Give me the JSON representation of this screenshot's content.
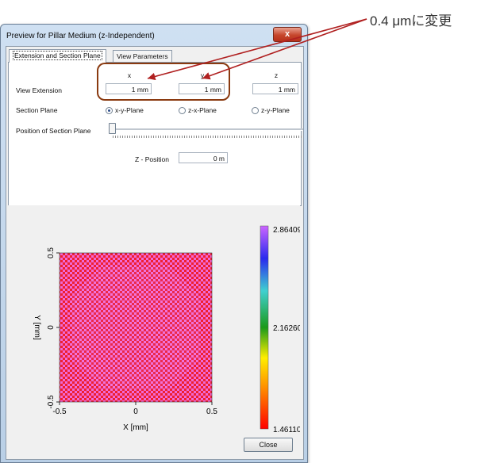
{
  "window": {
    "title": "Preview for Pillar Medium (z-Independent)",
    "close_glyph": "x"
  },
  "tabs": [
    {
      "label": "Extension and Section Plane",
      "active": true
    },
    {
      "label": "View Parameters",
      "active": false
    }
  ],
  "extension": {
    "headers": {
      "x": "x",
      "y": "y",
      "z": "z"
    },
    "label": "View Extension",
    "x_value": "1 mm",
    "y_value": "1 mm",
    "z_value": "1 mm"
  },
  "section_plane": {
    "label": "Section Plane",
    "options": [
      "x-y-Plane",
      "z-x-Plane",
      "z-y-Plane"
    ],
    "selected": "x-y-Plane"
  },
  "position": {
    "label": "Position of Section Plane",
    "z_label": "Z - Position",
    "z_value": "0 m"
  },
  "plot": {
    "xlabel": "X [mm]",
    "ylabel": "Y [mm]",
    "xticks": [
      "-0.5",
      "0",
      "0.5"
    ],
    "yticks": [
      "0.5",
      "0",
      "-0.5"
    ],
    "colorbar_labels": [
      "2.86409",
      "2.16260",
      "1.46110"
    ],
    "colors": {
      "low": "#ff1a1a",
      "high": "#e070e0",
      "checker_dark": "#ee2030",
      "checker_light": "#ef6ad8"
    }
  },
  "buttons": {
    "close": "Close"
  },
  "annotation": {
    "text": "0.4 μmに変更",
    "color": "#b02020"
  }
}
